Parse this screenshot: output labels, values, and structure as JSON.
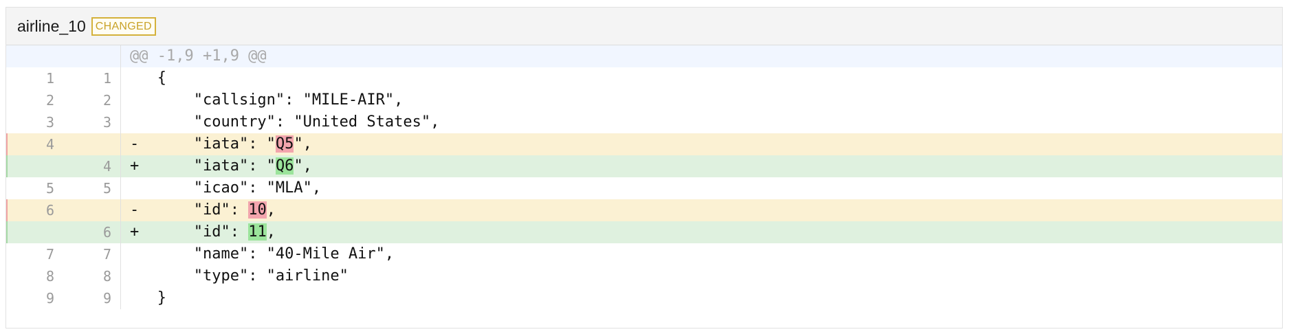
{
  "file": {
    "name": "airline_10",
    "status": "CHANGED"
  },
  "hunk": "@@ -1,9 +1,9 @@",
  "lines": [
    {
      "type": "ctx",
      "old": "1",
      "new": "1",
      "marker": "",
      "indent": "  ",
      "pre": "{",
      "hl": "",
      "post": ""
    },
    {
      "type": "ctx",
      "old": "2",
      "new": "2",
      "marker": "",
      "indent": "      ",
      "pre": "\"callsign\": \"MILE-AIR\",",
      "hl": "",
      "post": ""
    },
    {
      "type": "ctx",
      "old": "3",
      "new": "3",
      "marker": "",
      "indent": "      ",
      "pre": "\"country\": \"United States\",",
      "hl": "",
      "post": ""
    },
    {
      "type": "del",
      "old": "4",
      "new": "",
      "marker": "-",
      "indent": "      ",
      "pre": "\"iata\": \"",
      "hl": "Q5",
      "post": "\","
    },
    {
      "type": "add",
      "old": "",
      "new": "4",
      "marker": "+",
      "indent": "      ",
      "pre": "\"iata\": \"",
      "hl": "Q6",
      "post": "\","
    },
    {
      "type": "ctx",
      "old": "5",
      "new": "5",
      "marker": "",
      "indent": "      ",
      "pre": "\"icao\": \"MLA\",",
      "hl": "",
      "post": ""
    },
    {
      "type": "del",
      "old": "6",
      "new": "",
      "marker": "-",
      "indent": "      ",
      "pre": "\"id\": ",
      "hl": "10",
      "post": ","
    },
    {
      "type": "add",
      "old": "",
      "new": "6",
      "marker": "+",
      "indent": "      ",
      "pre": "\"id\": ",
      "hl": "11",
      "post": ","
    },
    {
      "type": "ctx",
      "old": "7",
      "new": "7",
      "marker": "",
      "indent": "      ",
      "pre": "\"name\": \"40-Mile Air\",",
      "hl": "",
      "post": ""
    },
    {
      "type": "ctx",
      "old": "8",
      "new": "8",
      "marker": "",
      "indent": "      ",
      "pre": "\"type\": \"airline\"",
      "hl": "",
      "post": ""
    },
    {
      "type": "ctx",
      "old": "9",
      "new": "9",
      "marker": "",
      "indent": "  ",
      "pre": "}",
      "hl": "",
      "post": ""
    }
  ]
}
